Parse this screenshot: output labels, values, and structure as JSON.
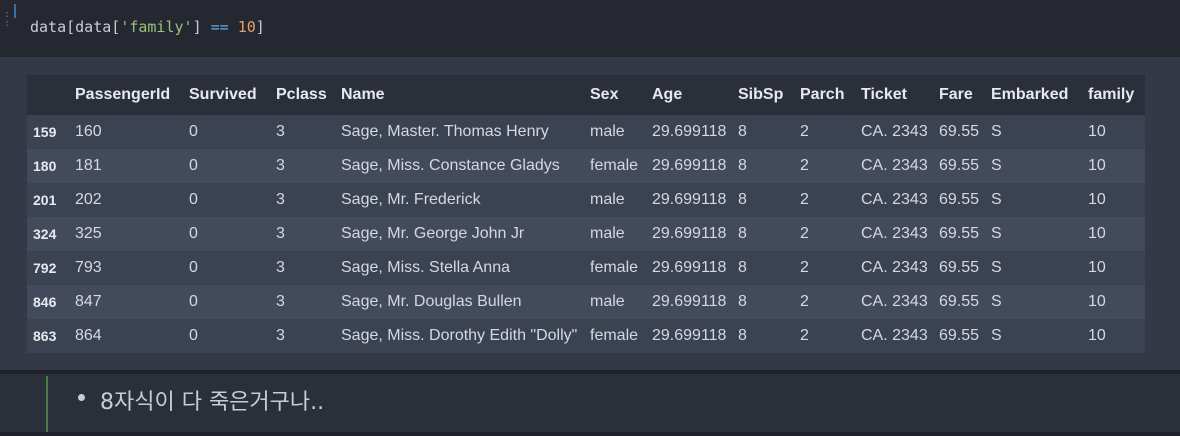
{
  "code_cell": {
    "tokens": {
      "t1": "data",
      "t2": "[",
      "t3": "data",
      "t4": "[",
      "t5": "'family'",
      "t6": "]",
      "t7": " == ",
      "t8": "10",
      "t9": "]"
    }
  },
  "table": {
    "columns": [
      "",
      "PassengerId",
      "Survived",
      "Pclass",
      "Name",
      "Sex",
      "Age",
      "SibSp",
      "Parch",
      "Ticket",
      "Fare",
      "Embarked",
      "family"
    ],
    "rows": [
      [
        "159",
        "160",
        "0",
        "3",
        "Sage, Master. Thomas Henry",
        "male",
        "29.699118",
        "8",
        "2",
        "CA. 2343",
        "69.55",
        "S",
        "10"
      ],
      [
        "180",
        "181",
        "0",
        "3",
        "Sage, Miss. Constance Gladys",
        "female",
        "29.699118",
        "8",
        "2",
        "CA. 2343",
        "69.55",
        "S",
        "10"
      ],
      [
        "201",
        "202",
        "0",
        "3",
        "Sage, Mr. Frederick",
        "male",
        "29.699118",
        "8",
        "2",
        "CA. 2343",
        "69.55",
        "S",
        "10"
      ],
      [
        "324",
        "325",
        "0",
        "3",
        "Sage, Mr. George John Jr",
        "male",
        "29.699118",
        "8",
        "2",
        "CA. 2343",
        "69.55",
        "S",
        "10"
      ],
      [
        "792",
        "793",
        "0",
        "3",
        "Sage, Miss. Stella Anna",
        "female",
        "29.699118",
        "8",
        "2",
        "CA. 2343",
        "69.55",
        "S",
        "10"
      ],
      [
        "846",
        "847",
        "0",
        "3",
        "Sage, Mr. Douglas Bullen",
        "male",
        "29.699118",
        "8",
        "2",
        "CA. 2343",
        "69.55",
        "S",
        "10"
      ],
      [
        "863",
        "864",
        "0",
        "3",
        "Sage, Miss. Dorothy Edith \"Dolly\"",
        "female",
        "29.699118",
        "8",
        "2",
        "CA. 2343",
        "69.55",
        "S",
        "10"
      ]
    ]
  },
  "markdown_cell": {
    "bullet_text": "8자식이 다 죽은거구나.."
  },
  "colors": {
    "background": "#2b2f3a",
    "code_background": "#252830",
    "string": "#98c379",
    "operator": "#61afef",
    "number": "#e5a06b"
  }
}
